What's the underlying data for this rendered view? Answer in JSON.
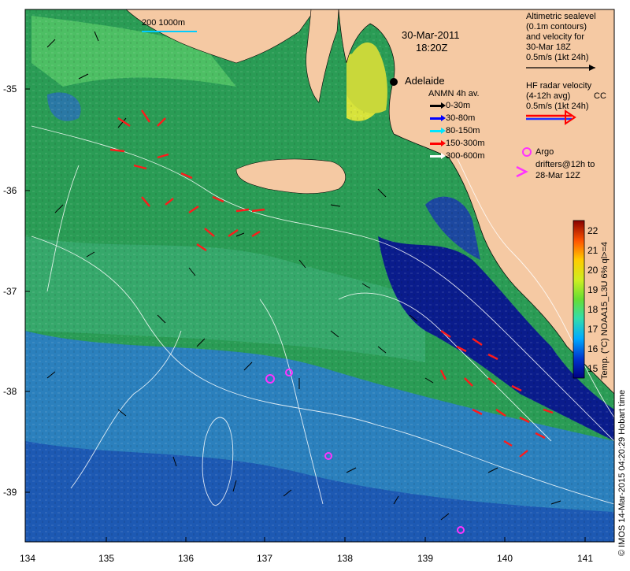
{
  "map": {
    "date": "30-Mar-2011",
    "time": "18:20Z",
    "city": "Adelaide",
    "scale_label": "200  1000m",
    "y_ticks": [
      "-35",
      "-36",
      "-37",
      "-38",
      "-39"
    ],
    "x_ticks": [
      "134",
      "135",
      "136",
      "137",
      "138",
      "139",
      "140",
      "141"
    ],
    "colorbar": {
      "ticks": [
        "22",
        "21",
        "20",
        "19",
        "18",
        "17",
        "16",
        "15"
      ],
      "range": [
        14.5,
        22.5
      ],
      "label": "Temp. (°C) NOAA15_L3U 6% ql>=4"
    },
    "credit": "© IMOS 14-Mar-2015 04:20:29 Hobart time",
    "legend": {
      "altimetry": [
        "Altimetric sealevel",
        "(0.1m contours)",
        "and velocity for",
        "30-Mar 18Z",
        "0.5m/s (1kt 24h)"
      ],
      "hf_radar": [
        "HF radar velocity",
        "(4-12h avg)",
        "0.5m/s (1kt 24h)"
      ],
      "hf_radar_station": "CC",
      "anmn_title": "ANMN 4h av.",
      "anmn_items": [
        {
          "label": "0-30m",
          "color": "#000000"
        },
        {
          "label": "30-80m",
          "color": "#0000ff"
        },
        {
          "label": "80-150m",
          "color": "#00e5ff"
        },
        {
          "label": "150-300m",
          "color": "#ff0000"
        },
        {
          "label": "300-600m",
          "color": "#ffffff"
        }
      ],
      "argo": "Argo",
      "drifters": [
        "drifters@12h to",
        "28-Mar 12Z"
      ]
    },
    "colors": {
      "land": "#f5c9a3",
      "ocean_warm": "#2f9f4a",
      "ocean_cool": "#1f63c8",
      "deep_blue": "#0a1a8a",
      "argo": "#ff33ff",
      "hf_vectors": "#ff0000"
    }
  }
}
